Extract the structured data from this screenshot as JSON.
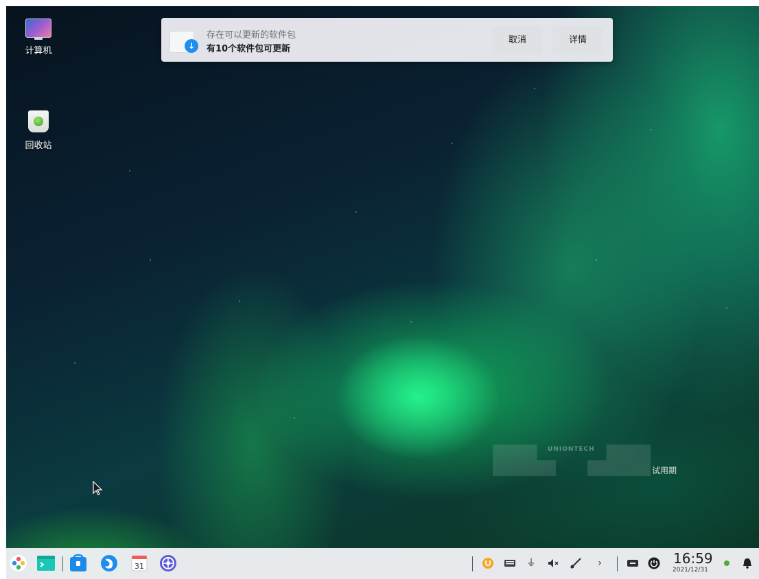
{
  "desktop": {
    "icons": [
      {
        "label": "计算机",
        "icon": "computer-icon"
      },
      {
        "label": "回收站",
        "icon": "trash-icon"
      }
    ]
  },
  "notification": {
    "title": "存在可以更新的软件包",
    "body": "有10个软件包可更新",
    "cancel_label": "取消",
    "details_label": "详情",
    "icon": "package-update-icon"
  },
  "watermark": {
    "brand": "UNIONTECH",
    "trial_label": "试用期"
  },
  "taskbar": {
    "apps": [
      {
        "name": "launcher",
        "icon": "launcher-icon"
      },
      {
        "name": "terminal",
        "icon": "terminal-icon"
      },
      {
        "name": "app-store",
        "icon": "app-store-icon"
      },
      {
        "name": "browser",
        "icon": "browser-icon"
      },
      {
        "name": "calendar",
        "icon": "calendar-icon",
        "day": "31"
      },
      {
        "name": "settings",
        "icon": "settings-icon"
      }
    ],
    "tray": [
      "uos-icon",
      "keyboard-icon",
      "usb-icon",
      "volume-muted-icon",
      "network-icon",
      "expand-icon",
      "onscreen-keyboard-icon",
      "power-icon",
      "user-icon",
      "notification-bell-icon"
    ],
    "clock": {
      "time": "16:59",
      "date": "2021/12/31"
    }
  },
  "colors": {
    "taskbar_bg": "#eef0f3",
    "notification_bg": "#e8eaee",
    "accent": "#1f8ef1",
    "update_orange": "#f5a623"
  }
}
